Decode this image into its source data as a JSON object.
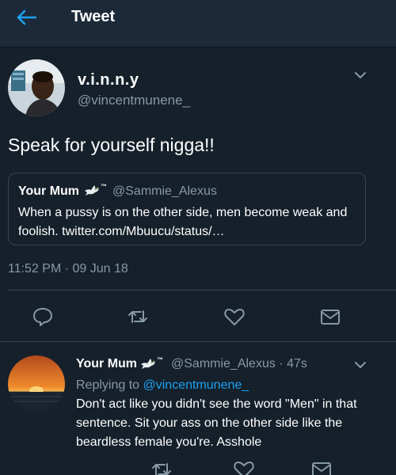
{
  "header": {
    "title": "Tweet",
    "back_icon": "back-arrow-icon",
    "background": "#1c2938"
  },
  "tweet": {
    "display_name": "v.i.n.n.y",
    "handle": "@vincentmunene_",
    "text": "Speak for yourself nigga!!",
    "timestamp": "11:52 PM · 09 Jun 18",
    "quote": {
      "display_name": "Your Mum",
      "badge": "™",
      "handle": "@Sammie_Alexus",
      "text": "When a pussy is on the other side, men become weak and foolish. twitter.com/Mbuucu/status/…"
    },
    "actions": [
      "reply-icon",
      "retweet-icon",
      "like-icon",
      "share-icon"
    ]
  },
  "reply": {
    "display_name": "Your Mum",
    "badge": "™",
    "handle_time": "@Sammie_Alexus · 47s",
    "replying_prefix": "Replying to",
    "replying_to": "@vincentmunene_",
    "text": "Don't act like you didn't see the word \"Men\" in that sentence. Sit your ass on the other side like the beardless female you're. Asshole",
    "actions": [
      "reply-icon",
      "retweet-icon",
      "like-icon",
      "share-icon"
    ]
  },
  "colors": {
    "background": "#15202b",
    "accent": "#1da1f2",
    "secondary_text": "#8899a6",
    "divider": "#38444d"
  }
}
